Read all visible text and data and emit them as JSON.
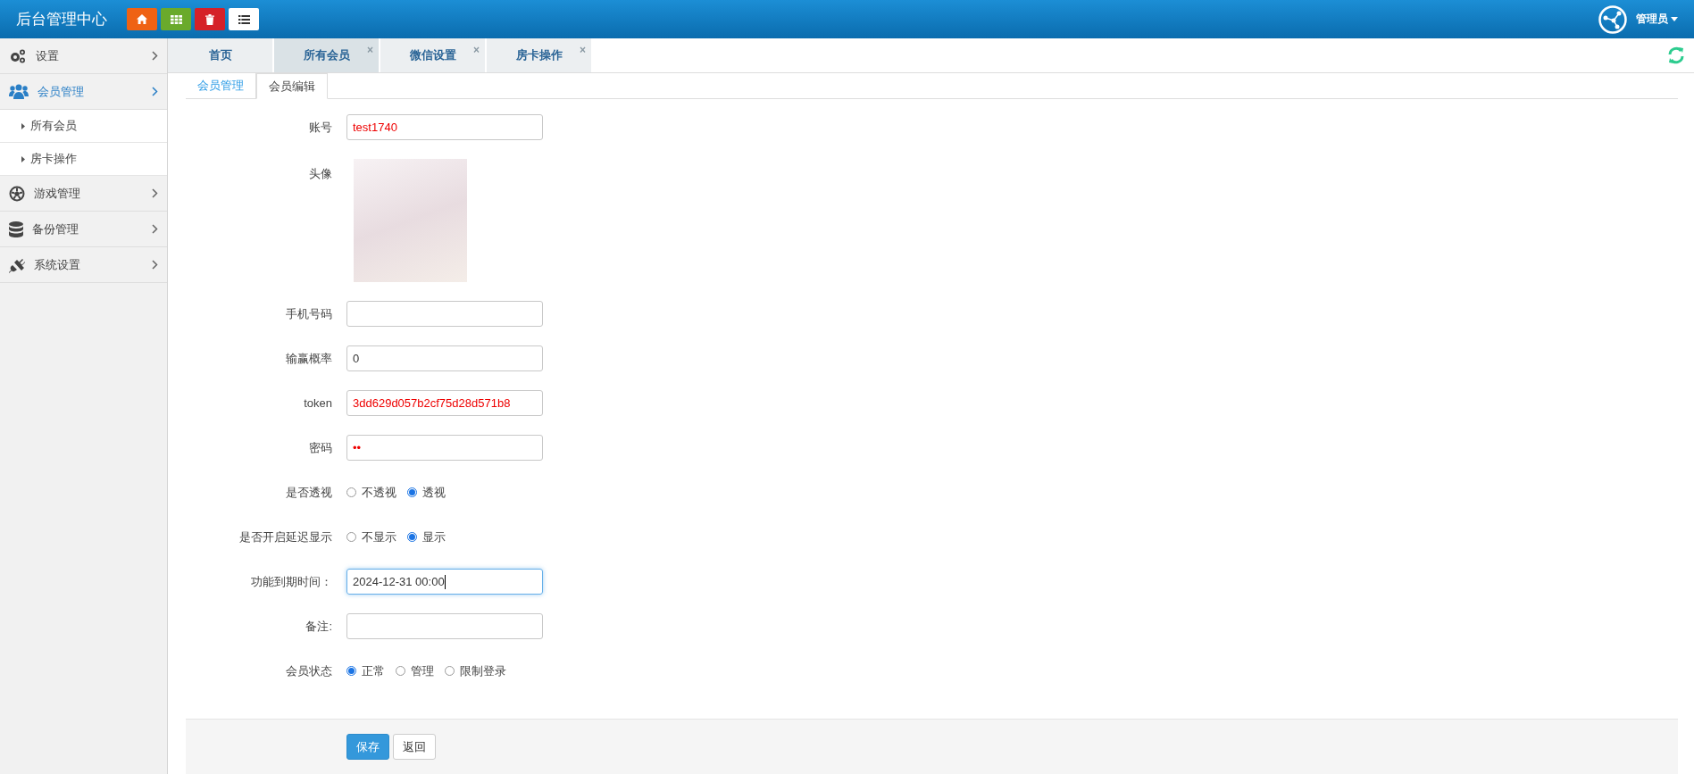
{
  "header": {
    "title": "后台管理中心",
    "quick_buttons": [
      {
        "kind": "home",
        "color": "#ef6213"
      },
      {
        "kind": "grid",
        "color": "#6aaa2b"
      },
      {
        "kind": "trash",
        "color": "#d52128"
      },
      {
        "kind": "list",
        "color": "#ffffff"
      }
    ],
    "user": "管理员"
  },
  "sidebar": {
    "items": [
      {
        "label": "设置",
        "expanded": false
      },
      {
        "label": "会员管理",
        "expanded": true,
        "children": [
          {
            "label": "所有会员"
          },
          {
            "label": "房卡操作"
          }
        ]
      },
      {
        "label": "游戏管理",
        "expanded": false
      },
      {
        "label": "备份管理",
        "expanded": false
      },
      {
        "label": "系统设置",
        "expanded": false
      }
    ]
  },
  "tabs": [
    {
      "label": "首页",
      "selected": false
    },
    {
      "label": "所有会员",
      "selected": true,
      "close": "×"
    },
    {
      "label": "微信设置",
      "selected": false,
      "close": "×"
    },
    {
      "label": "房卡操作",
      "selected": false,
      "close": "×"
    }
  ],
  "subtabs": [
    {
      "label": "会员管理",
      "selected": false
    },
    {
      "label": "会员编辑",
      "selected": true
    }
  ],
  "form": {
    "fields": [
      {
        "kind": "input",
        "label": "账号",
        "value": "test1740",
        "highlighted": true,
        "focused": false
      },
      {
        "kind": "image",
        "label": "头像"
      },
      {
        "kind": "input",
        "label": "手机号码",
        "focused": false
      },
      {
        "kind": "input",
        "label": "输赢概率",
        "value": "0",
        "highlighted": false,
        "focused": false
      },
      {
        "kind": "input",
        "label": "token",
        "value": "3dd629d057b2cf75d28d571b8",
        "highlighted": true,
        "focused": false
      },
      {
        "kind": "input",
        "label": "密码",
        "value": "••",
        "highlighted": true,
        "focused": false
      },
      {
        "kind": "radio",
        "label": "是否透视",
        "options": [
          {
            "label": "不透视",
            "selected": false
          },
          {
            "label": "透视",
            "selected": true
          }
        ]
      },
      {
        "kind": "radio",
        "label": "是否开启延迟显示",
        "options": [
          {
            "label": "不显示",
            "selected": false
          },
          {
            "label": "显示",
            "selected": true
          }
        ]
      },
      {
        "kind": "input",
        "label": "功能到期时间：",
        "value": "2024-12-31 00:00",
        "highlighted": false,
        "focused": true
      },
      {
        "kind": "input",
        "label": "备注:",
        "focused": false
      },
      {
        "kind": "radio",
        "label": "会员状态",
        "options": [
          {
            "label": "正常",
            "selected": true
          },
          {
            "label": "管理",
            "selected": false
          },
          {
            "label": "限制登录",
            "selected": false
          }
        ]
      }
    ],
    "buttons": [
      {
        "label": "保存",
        "kind": "primary"
      },
      {
        "label": "返回",
        "kind": "default"
      }
    ]
  }
}
